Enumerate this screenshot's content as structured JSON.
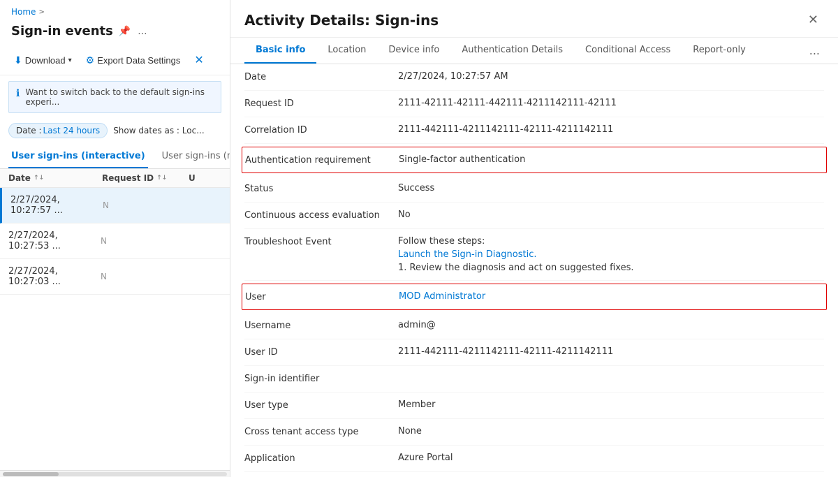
{
  "breadcrumb": {
    "home": "Home",
    "chevron": ">"
  },
  "left": {
    "page_title": "Sign-in events",
    "pin_icon": "📌",
    "more_icon": "...",
    "toolbar": {
      "download_label": "Download",
      "download_chevron": "▾",
      "export_label": "Export Data Settings",
      "close_icon": "✕"
    },
    "info_banner": "Want to switch back to the default sign-ins experi...",
    "filter": {
      "date_chip_label": "Date :",
      "date_chip_value": "Last 24 hours",
      "show_dates_label": "Show dates as : Loc..."
    },
    "tabs": [
      {
        "id": "interactive",
        "label": "User sign-ins (interactive)",
        "active": true
      },
      {
        "id": "non-interactive",
        "label": "User sign-ins (non...",
        "active": false
      }
    ],
    "table_headers": [
      {
        "label": "Date",
        "sort": "↑↓"
      },
      {
        "label": "Request ID",
        "sort": "↑↓"
      },
      {
        "label": "U",
        "sort": ""
      }
    ],
    "rows": [
      {
        "date": "2/27/2024, 10:27:57 ...",
        "reqid": "N",
        "active": true
      },
      {
        "date": "2/27/2024, 10:27:53 ...",
        "reqid": "N",
        "active": false
      },
      {
        "date": "2/27/2024, 10:27:03 ...",
        "reqid": "N",
        "active": false
      }
    ]
  },
  "right": {
    "panel_title": "Activity Details: Sign-ins",
    "close_icon": "✕",
    "tabs": [
      {
        "id": "basic",
        "label": "Basic info",
        "active": true
      },
      {
        "id": "location",
        "label": "Location",
        "active": false
      },
      {
        "id": "device",
        "label": "Device info",
        "active": false
      },
      {
        "id": "auth",
        "label": "Authentication Details",
        "active": false
      },
      {
        "id": "conditional",
        "label": "Conditional Access",
        "active": false
      },
      {
        "id": "report",
        "label": "Report-only",
        "active": false
      }
    ],
    "more_icon": "...",
    "details": [
      {
        "id": "date",
        "label": "Date",
        "value": "2/27/2024, 10:27:57 AM",
        "highlighted": false,
        "is_link": false
      },
      {
        "id": "request-id",
        "label": "Request ID",
        "value": "2111-42111-42111-442111-4211142111-42111",
        "highlighted": false,
        "is_link": false
      },
      {
        "id": "correlation-id",
        "label": "Correlation ID",
        "value": "2111-442111-4211142111-42111-4211142111",
        "highlighted": false,
        "is_link": false
      },
      {
        "id": "auth-requirement",
        "label": "Authentication requirement",
        "value": "Single-factor authentication",
        "highlighted": true,
        "is_link": false
      },
      {
        "id": "status",
        "label": "Status",
        "value": "Success",
        "highlighted": false,
        "is_link": false
      },
      {
        "id": "continuous-access",
        "label": "Continuous access evaluation",
        "value": "No",
        "highlighted": false,
        "is_link": false
      }
    ],
    "troubleshoot": {
      "label": "Troubleshoot Event",
      "follow_steps": "Follow these steps:",
      "link_label": "Launch the Sign-in Diagnostic.",
      "review_text": "1. Review the diagnosis and act on suggested fixes."
    },
    "user_details": [
      {
        "id": "user",
        "label": "User",
        "value": "MOD Administrator",
        "highlighted": true,
        "is_link": true
      },
      {
        "id": "username",
        "label": "Username",
        "value": "admin@",
        "highlighted": false,
        "is_link": false
      },
      {
        "id": "user-id",
        "label": "User ID",
        "value": "2111-442111-4211142111-42111-4211142111",
        "highlighted": false,
        "is_link": false
      },
      {
        "id": "signin-identifier",
        "label": "Sign-in identifier",
        "value": "",
        "highlighted": false,
        "is_link": false
      },
      {
        "id": "user-type",
        "label": "User type",
        "value": "Member",
        "highlighted": false,
        "is_link": false
      },
      {
        "id": "cross-tenant",
        "label": "Cross tenant access type",
        "value": "None",
        "highlighted": false,
        "is_link": false
      },
      {
        "id": "application",
        "label": "Application",
        "value": "Azure Portal",
        "highlighted": false,
        "is_link": false
      }
    ]
  }
}
